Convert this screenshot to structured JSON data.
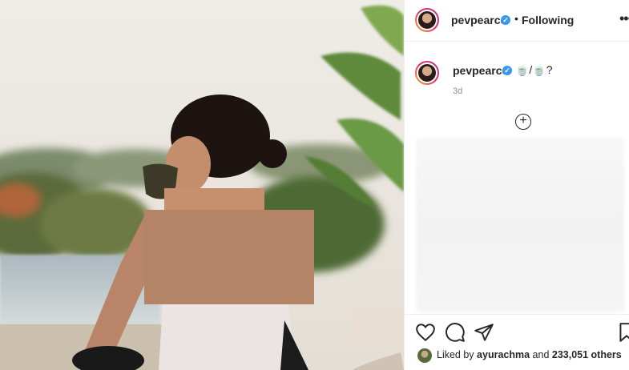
{
  "header": {
    "username": "pevpearce",
    "verified_mark": "✓",
    "separator": "•",
    "follow_status": "Following",
    "more_label": "•••"
  },
  "caption": {
    "username": "pevpearce",
    "verified_mark": "✓",
    "text": "🍵/🍵?",
    "age": "3d"
  },
  "add_comment": {
    "label": "+"
  },
  "likes": {
    "prefix": "Liked by",
    "user": "ayurachma",
    "joiner": "and",
    "others": "233,051 others"
  },
  "icons": [
    "heart-icon",
    "comment-icon",
    "share-icon",
    "bookmark-icon",
    "more-icon",
    "verified-icon",
    "add-icon"
  ],
  "colors": {
    "verified": "#3897f0",
    "muted": "#8e8e8e",
    "text": "#262626"
  }
}
